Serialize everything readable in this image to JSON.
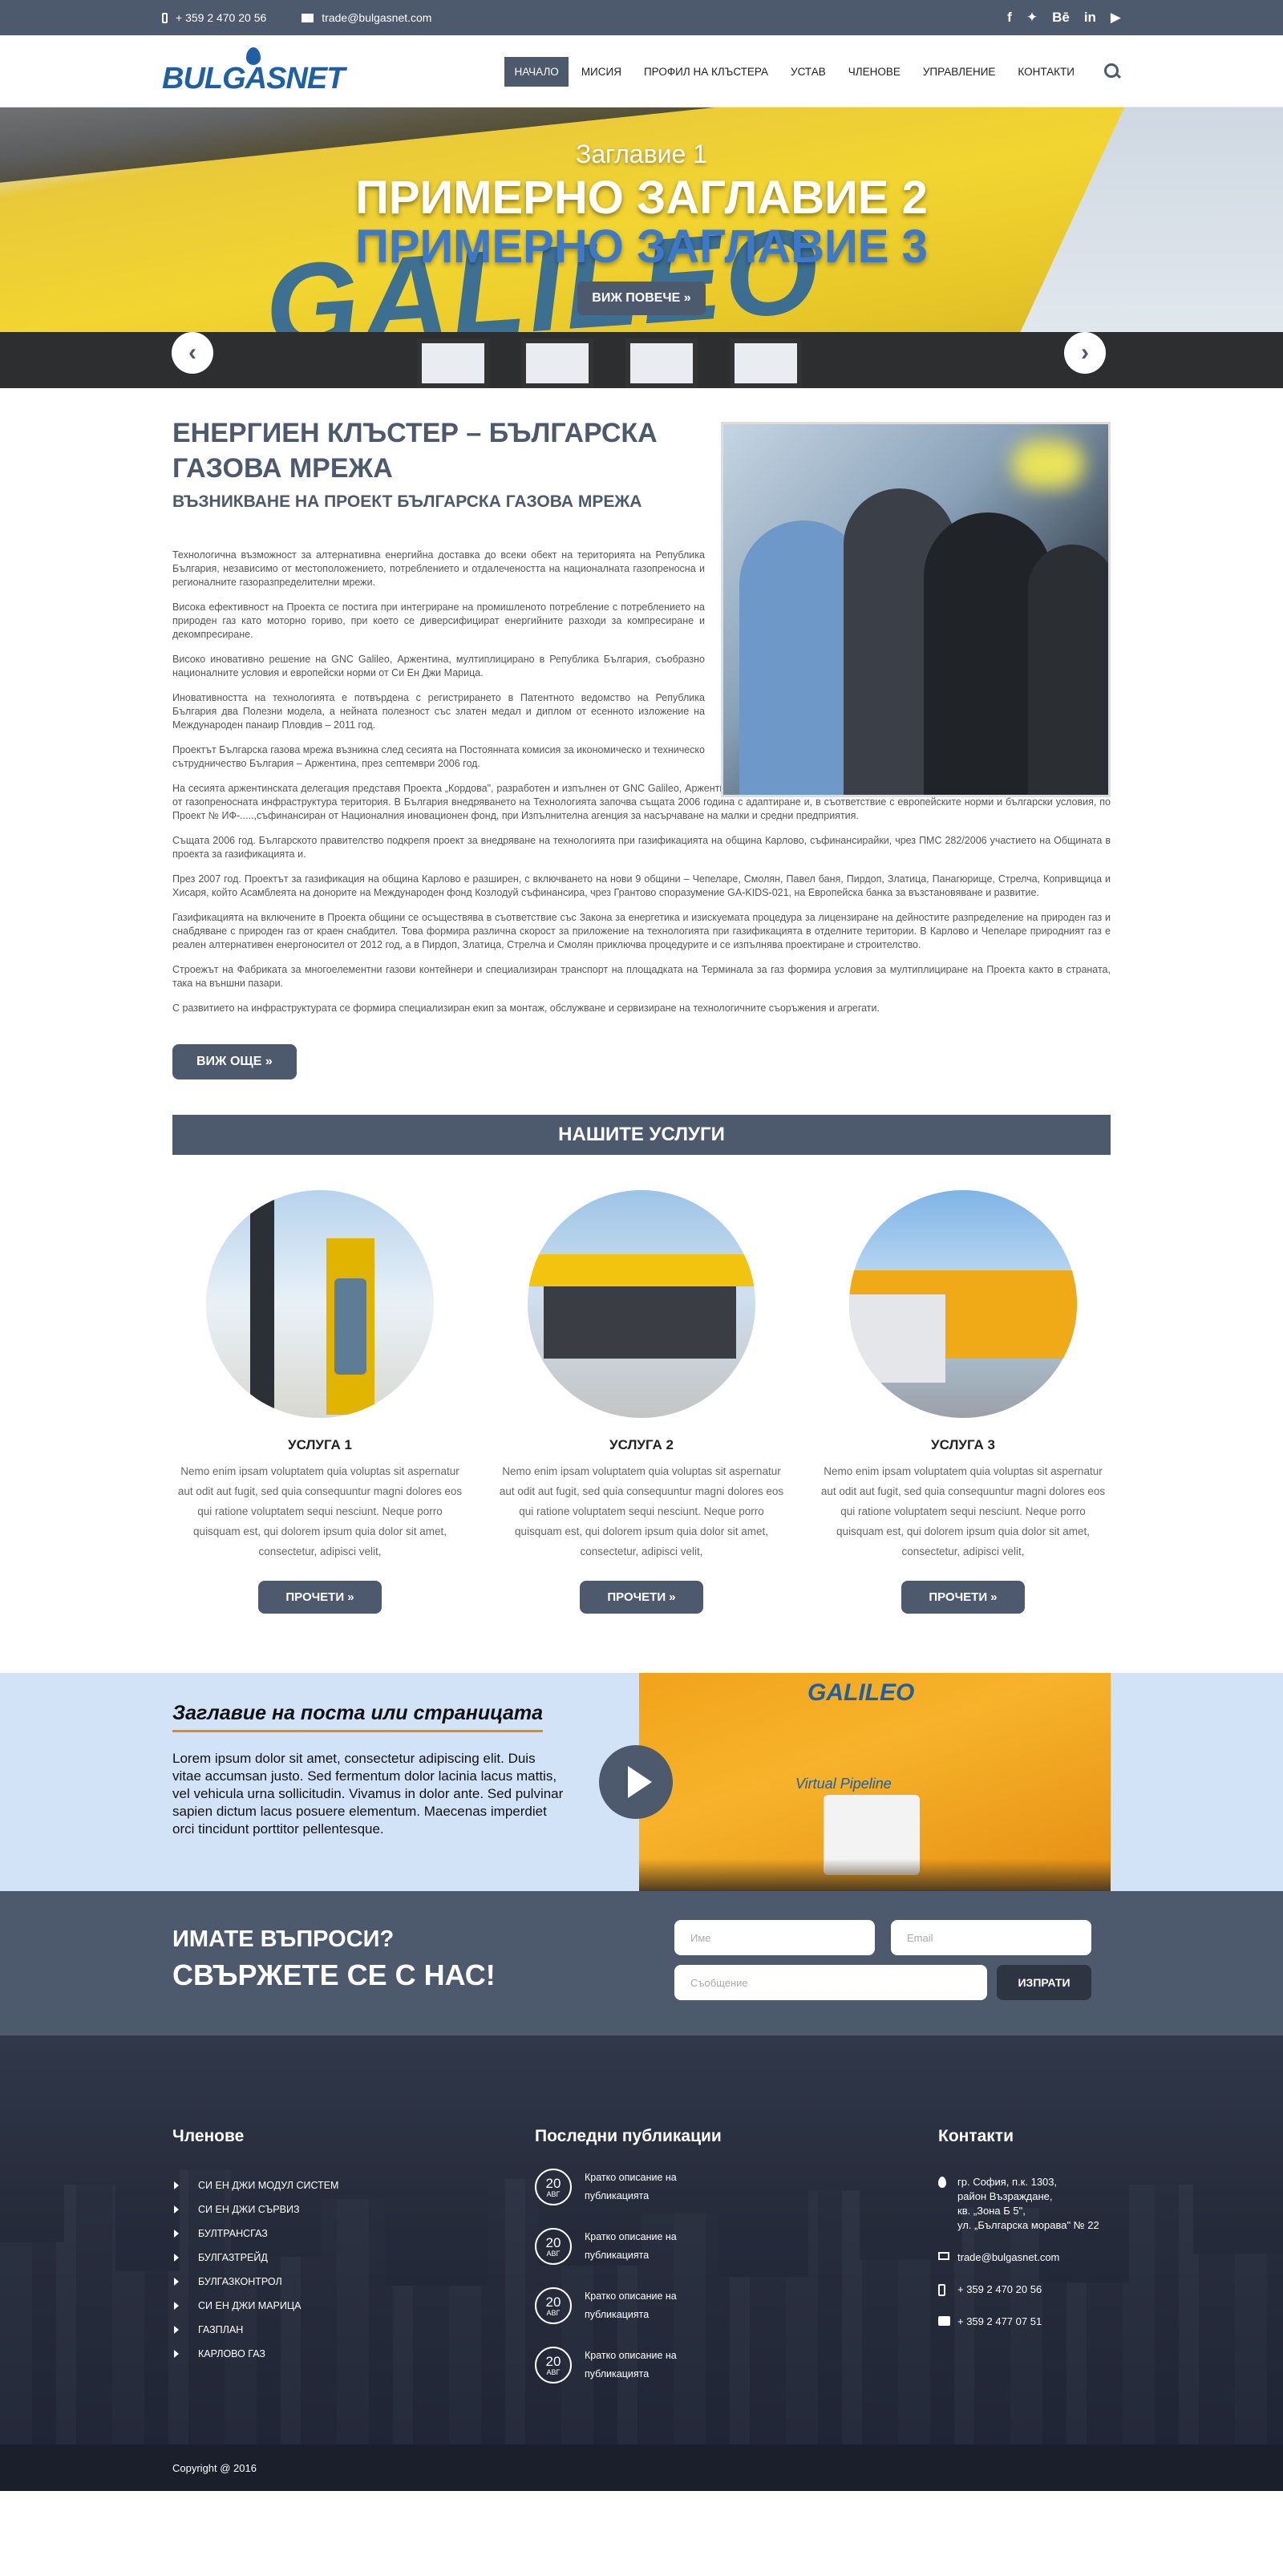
{
  "topbar": {
    "phone": "+ 359 2 470 20 56",
    "email": "trade@bulgasnet.com",
    "social": [
      "facebook-icon",
      "twitter-icon",
      "behance-icon",
      "linkedin-icon",
      "youtube-icon"
    ]
  },
  "header": {
    "logo": "BULGASNET",
    "nav": [
      "НАЧАЛО",
      "МИСИЯ",
      "ПРОФИЛ НА КЛЪСТЕРА",
      "УСТАВ",
      "ЧЛЕНОВЕ",
      "УПРАВЛЕНИЕ",
      "КОНТАКТИ"
    ],
    "active_index": 0
  },
  "slider": {
    "caption1": "Заглавие 1",
    "caption2": "ПРИМЕРНО ЗАГЛАВИЕ 2",
    "caption3": "ПРИМЕРНО ЗАГЛАВИЕ 3",
    "button": "ВИЖ ПОВЕЧЕ »",
    "image_text": "GALILEO",
    "prev": "‹",
    "next": "›"
  },
  "about": {
    "title": "ЕНЕРГИЕН КЛЪСТЕР – БЪЛГАРСКА ГАЗОВА МРЕЖА",
    "subtitle": "ВЪЗНИКВАНЕ НА ПРОЕКТ БЪЛГАРСКА ГАЗОВА МРЕЖА",
    "paragraphs": [
      "Технологична възможност за алтернативна енергийна доставка до всеки обект на територията на Република България, независимо от местоположението, потреблението и отдалечеността на националната газопреносна и регионалните газоразпределителни мрежи.",
      "Висока ефективност на Проекта се постига при интегриране на промишленото потребление с потреблението на природен газ като моторно гориво, при което се диверсифицират енергийните разходи за компресиране и декомпресиране.",
      "Високо иновативно решение на GNC Galileo, Аржентина, мултиплицирано в Република България, съобразно националните условия и европейски норми от Си Ен Джи Марица.",
      "Иновативността на технологията е потвърдена с регистрирането в Патентното ведомство на Република България два Полезни модела, а нейната полезност със златен медал и диплом от есенното изложение на Международен панаир Пловдив – 2011 год.",
      "Проектът Българска газова мрежа възникна след сесията на Постоянната комисия за икономическо и техническо сътрудничество България – Аржентина, през септември 2006 год.",
      "На сесията аржентинската делегация представя Проекта „Кордова\", разработен и изпълнен от GNC Galileo, Аржентина, чрез високо технологично решение за доставка на природен газ в отдалечена от газопреносната инфраструктура територия. В България внедряването на Технологията започва същата 2006 година с адаптиране и, в съответствие с европейските норми и български условия, по Проект № ИФ-.....,съфинансиран от Националния иновационен фонд, при Изпълнителна агенция за насърчаване на малки и средни предприятия.",
      "Същата 2006 год. Българското правителство подкрепя проект за внедряване на технологията при газификацията на община Карлово, съфинансирайки, чрез ПМС 282/2006 участието на Общината в проекта за газификацията и.",
      "През 2007 год. Проектът за газификация на община Карлово е разширен, с включването на нови 9 общини – Чепеларе, Смолян, Павел баня, Пирдоп, Златица, Панагюрище, Стрелча, Копривщица и Хисаря, който Асамблеята на донорите на Международен фонд Козлодуй съфинансира, чрез Грантово споразумение GA-KIDS-021, на Европейска банка за възстановяване и развитие.",
      "Газификацията на включените в Проекта общини се осъществява в съответствие със Закона за енергетика и изискуемата процедура за лицензиране на дейностите разпределение на природен газ и снабдяване с природен газ от краен снабдител. Това формира различна скорост за приложение на технологията при газификацията в отделните територии. В Карлово и Чепеларе природният газ е реален алтернативен енергоносител от 2012 год, а в Пирдоп, Златица, Стрелча и Смолян приключва процедурите и се изпълнява проектиране и строителство.",
      "Строежът на Фабриката за многоелементни газови контейнери и специализиран транспорт на площадката на Терминала за газ формира условия за мултиплициране на Проекта както в страната, така на външни пазари.",
      "С развитието на инфраструктурата се формира специализиран екип за монтаж, обслужване и сервизиране на технологичните съоръжения и агрегати."
    ],
    "more_button": "ВИЖ ОЩЕ »"
  },
  "services": {
    "heading": "НАШИТЕ УСЛУГИ",
    "items": [
      {
        "title": "УСЛУГА 1",
        "text": "Nemo enim ipsam voluptatem quia voluptas sit aspernatur aut odit aut fugit, sed quia consequuntur magni dolores eos qui ratione voluptatem sequi nesciunt. Neque porro quisquam est, qui dolorem ipsum quia dolor sit amet, consectetur, adipisci velit,",
        "button": "ПРОЧЕТИ »"
      },
      {
        "title": "УСЛУГА 2",
        "text": "Nemo enim ipsam voluptatem quia voluptas sit aspernatur aut odit aut fugit, sed quia consequuntur magni dolores eos qui ratione voluptatem sequi nesciunt. Neque porro quisquam est, qui dolorem ipsum quia dolor sit amet, consectetur, adipisci velit,",
        "button": "ПРОЧЕТИ »"
      },
      {
        "title": "УСЛУГА 3",
        "text": "Nemo enim ipsam voluptatem quia voluptas sit aspernatur aut odit aut fugit, sed quia consequuntur magni dolores eos qui ratione voluptatem sequi nesciunt. Neque porro quisquam est, qui dolorem ipsum quia dolor sit amet, consectetur, adipisci velit,",
        "button": "ПРОЧЕТИ »"
      }
    ]
  },
  "post": {
    "title": "Заглавие на поста или страницата",
    "body": "Lorem ipsum dolor sit amet, consectetur adipiscing elit. Duis vitae accumsan justo. Sed fermentum dolor lacinia lacus mattis, vel vehicula urna sollicitudin. Vivamus in dolor ante. Sed pulvinar sapien dictum lacus posuere elementum. Maecenas imperdiet orci tincidunt porttitor pellentesque.",
    "image_brand": "GALILEO",
    "image_label": "Virtual Pipeline"
  },
  "ask": {
    "line1": "ИМАТЕ ВЪПРОСИ?",
    "line2": "СВЪРЖЕТЕ СЕ С НАС!",
    "name_placeholder": "Име",
    "email_placeholder": "Email",
    "message_placeholder": "Съобщение",
    "send": "ИЗПРАТИ"
  },
  "footer": {
    "members_title": "Членове",
    "members": [
      "СИ ЕН ДЖИ МОДУЛ СИСТЕМ",
      "СИ ЕН ДЖИ СЪРВИЗ",
      "БУЛТРАНСГАЗ",
      "БУЛГАЗТРЕЙД",
      "БУЛГАЗКОНТРОЛ",
      "СИ ЕН ДЖИ МАРИЦА",
      "ГАЗПЛАН",
      "КАРЛОВО ГАЗ"
    ],
    "pubs_title": "Последни публикации",
    "pubs": [
      {
        "day": "20",
        "month": "АВГ",
        "text": "Кратко описание на публикацията"
      },
      {
        "day": "20",
        "month": "АВГ",
        "text": "Кратко описание на публикацията"
      },
      {
        "day": "20",
        "month": "АВГ",
        "text": "Кратко описание на публикацията"
      },
      {
        "day": "20",
        "month": "АВГ",
        "text": "Кратко описание на публикацията"
      }
    ],
    "contacts_title": "Контакти",
    "address": [
      "гр. София, п.к. 1303,",
      "район Възраждане,",
      "кв. „Зона Б 5\",",
      "ул. „Българска морава\" № 22"
    ],
    "email": "trade@bulgasnet.com",
    "phone": "+ 359 2 470 20 56",
    "fax": "+ 359 2 477 07 51",
    "copyright": "Copyright @ 2016"
  }
}
